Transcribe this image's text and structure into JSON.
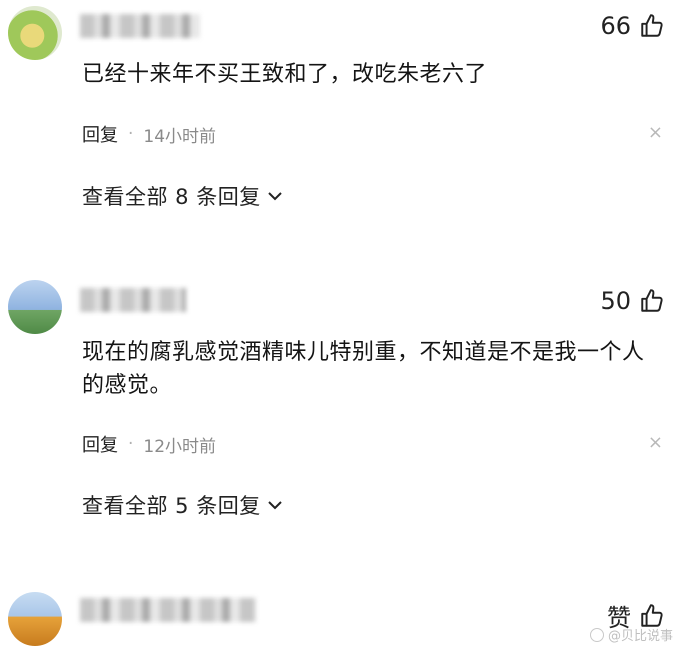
{
  "comments": [
    {
      "likes": "66",
      "text": "已经十来年不买王致和了，改吃朱老六了",
      "reply": "回复",
      "dot": "·",
      "time": "14小时前",
      "view_replies": "查看全部 8 条回复"
    },
    {
      "likes": "50",
      "text": "现在的腐乳感觉酒精味儿特别重，不知道是不是我一个人的感觉。",
      "reply": "回复",
      "dot": "·",
      "time": "12小时前",
      "view_replies": "查看全部 5 条回复"
    },
    {
      "likes": "赞"
    }
  ],
  "close_symbol": "×",
  "watermark": "@贝比说事"
}
